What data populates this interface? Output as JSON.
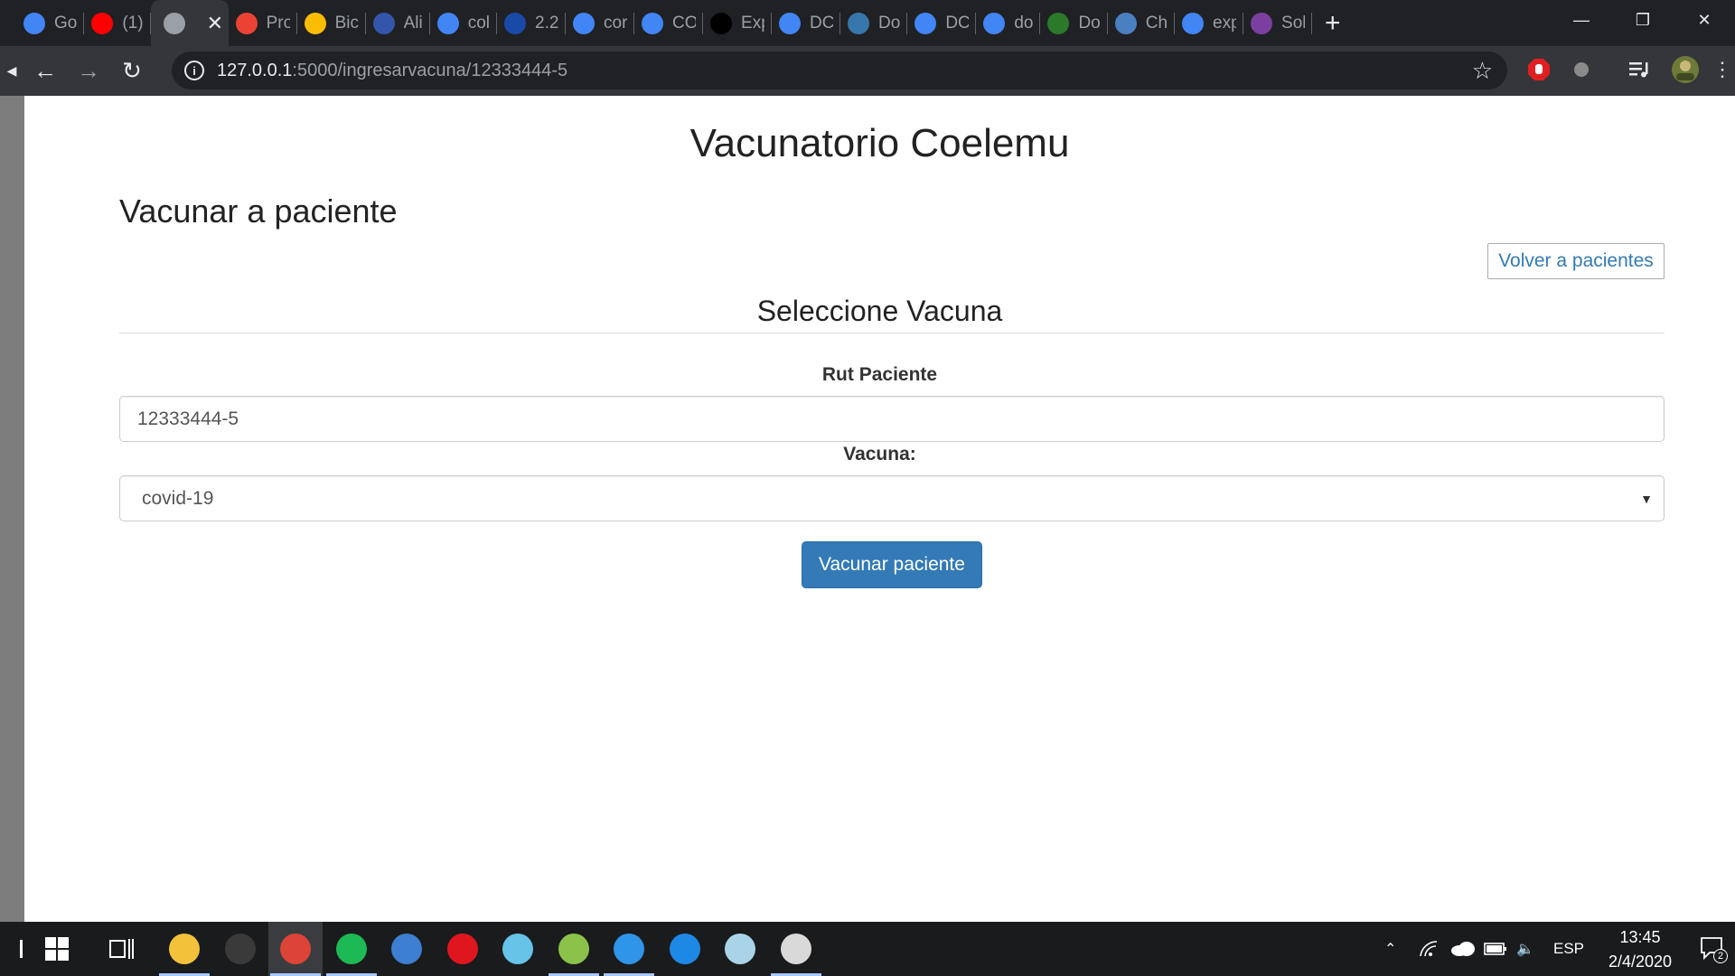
{
  "browser": {
    "tabs": [
      {
        "label": "Go",
        "icon": "google-icon",
        "color": "#4285f4"
      },
      {
        "label": "(1)",
        "icon": "youtube-icon",
        "color": "#ff0000"
      },
      {
        "label": "",
        "icon": "globe-icon",
        "color": "#9aa0a6",
        "active": true
      },
      {
        "label": "Pro",
        "icon": "gmail-icon",
        "color": "#ea4335"
      },
      {
        "label": "Bic",
        "icon": "google-drive-icon",
        "color": "#fbbc04"
      },
      {
        "label": "Ali",
        "icon": "hcc-icon",
        "color": "#3355aa"
      },
      {
        "label": "col",
        "icon": "google-icon",
        "color": "#4285f4"
      },
      {
        "label": "2.2",
        "icon": "diamond-icon",
        "color": "#1a4aa8"
      },
      {
        "label": "cor",
        "icon": "google-icon",
        "color": "#4285f4"
      },
      {
        "label": "CO",
        "icon": "google-icon",
        "color": "#4285f4"
      },
      {
        "label": "Exp",
        "icon": "a-logo-icon",
        "color": "#000000"
      },
      {
        "label": "DC",
        "icon": "google-icon",
        "color": "#4285f4"
      },
      {
        "label": "Do",
        "icon": "python-icon",
        "color": "#3776ab"
      },
      {
        "label": "DC",
        "icon": "google-icon",
        "color": "#4285f4"
      },
      {
        "label": "do",
        "icon": "google-icon",
        "color": "#4285f4"
      },
      {
        "label": "Do",
        "icon": "hs-icon",
        "color": "#2a7a2a"
      },
      {
        "label": "Ch",
        "icon": "chart-icon",
        "color": "#4a7fc1"
      },
      {
        "label": "exp",
        "icon": "google-icon",
        "color": "#4285f4"
      },
      {
        "label": "Sol",
        "icon": "infinity-icon",
        "color": "#7b3fa0"
      }
    ],
    "url_host": "127.0.0.1",
    "url_path": ":5000/ingresarvacuna/12333444-5"
  },
  "page": {
    "site_title": "Vacunatorio Coelemu",
    "subtitle": "Vacunar a paciente",
    "back_button": "Volver a pacientes",
    "section_title": "Seleccione Vacuna",
    "rut_label": "Rut Paciente",
    "rut_value": "12333444-5",
    "vacuna_label": "Vacuna:",
    "vacuna_selected": "covid-19",
    "submit_label": "Vacunar paciente"
  },
  "taskbar": {
    "apps": [
      {
        "name": "file-explorer-icon",
        "color": "#f3c13a",
        "running": true
      },
      {
        "name": "notion-icon",
        "color": "#3a3a3a",
        "running": false
      },
      {
        "name": "chrome-icon",
        "color": "#db4437",
        "running": true,
        "active": true
      },
      {
        "name": "spotify-icon",
        "color": "#1db954",
        "running": true
      },
      {
        "name": "qbittorrent-icon",
        "color": "#3d7fd1",
        "running": false
      },
      {
        "name": "opera-icon",
        "color": "#e0161f",
        "running": false
      },
      {
        "name": "atom-icon",
        "color": "#66c4e8",
        "running": false
      },
      {
        "name": "hs-app-icon",
        "color": "#8bc34a",
        "running": true
      },
      {
        "name": "vscode-icon",
        "color": "#2e95e8",
        "running": true
      },
      {
        "name": "edge-icon",
        "color": "#1e88e5",
        "running": false
      },
      {
        "name": "notes-icon",
        "color": "#a9d4e8",
        "running": false
      },
      {
        "name": "paint-icon",
        "color": "#d9d9d9",
        "running": true
      }
    ],
    "language": "ESP",
    "time": "13:45",
    "date": "2/4/2020",
    "notifications": "2"
  }
}
